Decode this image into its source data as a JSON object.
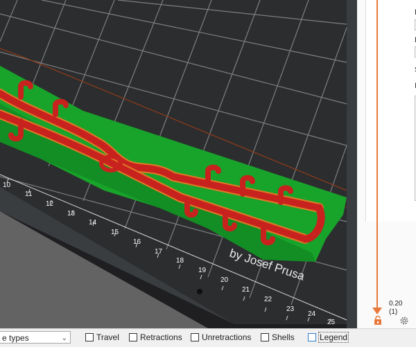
{
  "viewport": {
    "bed_ruler_numbers": [
      "10",
      "11",
      "12",
      "13",
      "14",
      "15",
      "16",
      "17",
      "18",
      "19",
      "20",
      "21",
      "22",
      "23",
      "24",
      "25"
    ],
    "model_text": "by Josef Prusa",
    "colors": {
      "background": "#3a3d40",
      "bed": "#2a2b2d",
      "grid": "#cfd2d4",
      "perimeter": "#c8221f",
      "infill": "#18a32a",
      "support": "#e07a25"
    }
  },
  "settings_panel": {
    "labels": [
      "F",
      "F",
      "S",
      "I"
    ]
  },
  "layer_slider": {
    "height": "0.20",
    "layer": "(1)",
    "accent": "#e8793b"
  },
  "bottom_bar": {
    "view_type": "e types",
    "checkboxes": [
      {
        "label": "Travel",
        "checked": false
      },
      {
        "label": "Retractions",
        "checked": false
      },
      {
        "label": "Unretractions",
        "checked": false
      },
      {
        "label": "Shells",
        "checked": false
      },
      {
        "label": "Legend",
        "checked": false
      }
    ]
  }
}
